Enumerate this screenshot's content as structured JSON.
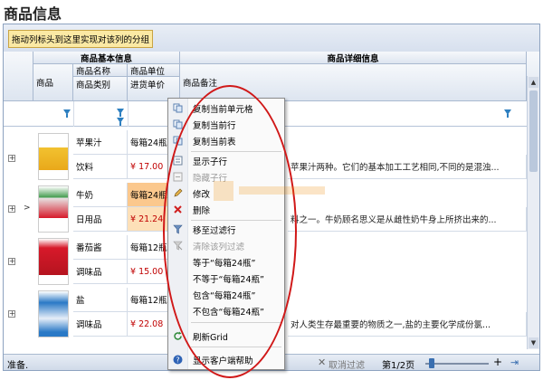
{
  "page": {
    "title": "商品信息"
  },
  "grid": {
    "group_by_hint": "拖动列标头到这里实现对该列的分组",
    "band_headers": {
      "basic": "商品基本信息",
      "detail": "商品详细信息"
    },
    "columns": {
      "product": "商品",
      "name": "商品名称",
      "category": "商品类别",
      "unit": "商品单位",
      "purchase_price": "进货单价",
      "remark": "商品备注"
    },
    "rows": [
      {
        "name": "苹果汁",
        "category": "饮料",
        "unit": "每箱24瓶",
        "price": "¥ 17.00",
        "remark": "苹果汁两种。它们的基本加工工艺相同,不同的是混浊..."
      },
      {
        "name": "牛奶",
        "category": "日用品",
        "unit": "每箱24瓶",
        "price": "¥ 21.24",
        "remark": "料之一。牛奶顾名思义是从雌性奶牛身上所挤出来的..."
      },
      {
        "name": "番茄酱",
        "category": "调味品",
        "unit": "每箱12瓶",
        "price": "¥ 15.00",
        "remark": ""
      },
      {
        "name": "盐",
        "category": "调味品",
        "unit": "每箱12瓶",
        "price": "¥ 22.08",
        "remark": "对人类生存最重要的物质之一,盐的主要化学成份氯..."
      }
    ]
  },
  "context_menu": {
    "items": [
      {
        "label": "复制当前单元格",
        "icon": "copy-cell-icon",
        "disabled": false
      },
      {
        "label": "复制当前行",
        "icon": "copy-row-icon",
        "disabled": false
      },
      {
        "label": "复制当前表",
        "icon": "copy-table-icon",
        "disabled": false
      },
      {
        "label": "显示子行",
        "icon": "show-child-rows-icon",
        "disabled": false
      },
      {
        "label": "隐藏子行",
        "icon": "hide-child-rows-icon",
        "disabled": true
      },
      {
        "label": "修改",
        "icon": "edit-pencil-icon",
        "disabled": false
      },
      {
        "label": "删除",
        "icon": "delete-x-icon",
        "disabled": false
      },
      {
        "label": "移至过滤行",
        "icon": "move-to-filter-icon",
        "disabled": false
      },
      {
        "label": "清除该列过滤",
        "icon": "clear-filter-icon",
        "disabled": true
      },
      {
        "label": "等于“每箱24瓶”",
        "icon": "",
        "disabled": false
      },
      {
        "label": "不等于“每箱24瓶”",
        "icon": "",
        "disabled": false
      },
      {
        "label": "包含“每箱24瓶”",
        "icon": "",
        "disabled": false
      },
      {
        "label": "不包含“每箱24瓶”",
        "icon": "",
        "disabled": false
      },
      {
        "label": "刷新Grid",
        "icon": "refresh-icon",
        "disabled": false
      },
      {
        "label": "显示客户端帮助",
        "icon": "help-icon",
        "disabled": false
      }
    ]
  },
  "footer": {
    "status": "准备.",
    "clear_filter": "取消过滤",
    "page": "第1/2页"
  },
  "colors": {
    "header_bg": "#dde5f0",
    "price_red": "#c00000",
    "highlight_orange": "#fbc88d",
    "annotation_red": "#d01818"
  }
}
